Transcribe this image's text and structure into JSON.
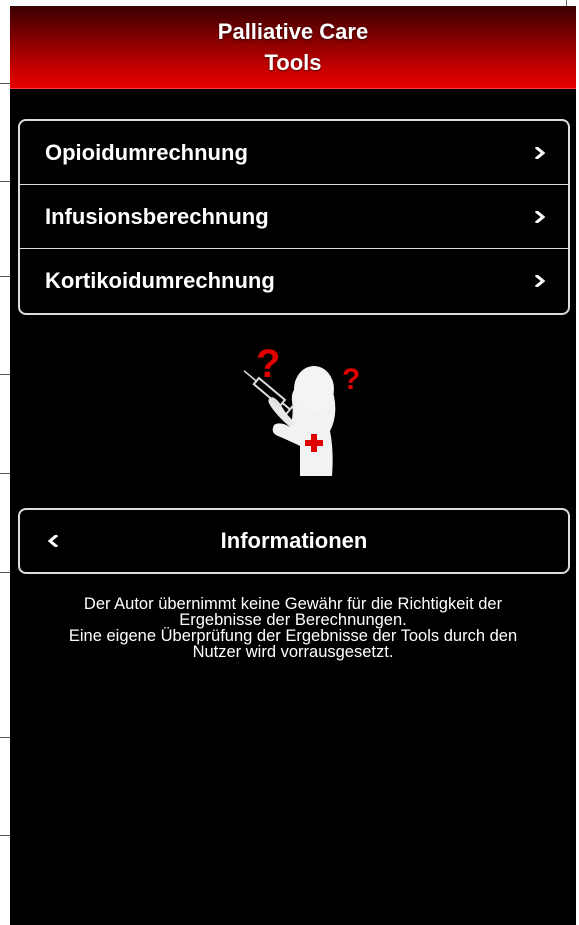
{
  "header": {
    "title_line1": "Palliative Care",
    "title_line2": "Tools"
  },
  "menu": {
    "items": [
      {
        "label": "Opioidumrechnung"
      },
      {
        "label": "Infusionsberechnung"
      },
      {
        "label": "Kortikoidumrechnung"
      }
    ]
  },
  "illustration": {
    "icon": "confused-figure-with-syringe",
    "question_marks": [
      "?",
      "?"
    ]
  },
  "info_button": {
    "label": "Informationen"
  },
  "disclaimer": {
    "line1": "Der Autor übernimmt keine Gewähr für die Richtigkeit der",
    "line2": "Ergebnisse der Berechnungen.",
    "line3": "Eine eigene Überprüfung der Ergebnisse der Tools durch den",
    "line4": "Nutzer wird vorrausgesetzt."
  },
  "colors": {
    "header_dark": "#3a0000",
    "header_bright": "#e60000",
    "accent_red": "#e00000",
    "background": "#000000",
    "text": "#ffffff",
    "border": "#dcdcdc"
  }
}
